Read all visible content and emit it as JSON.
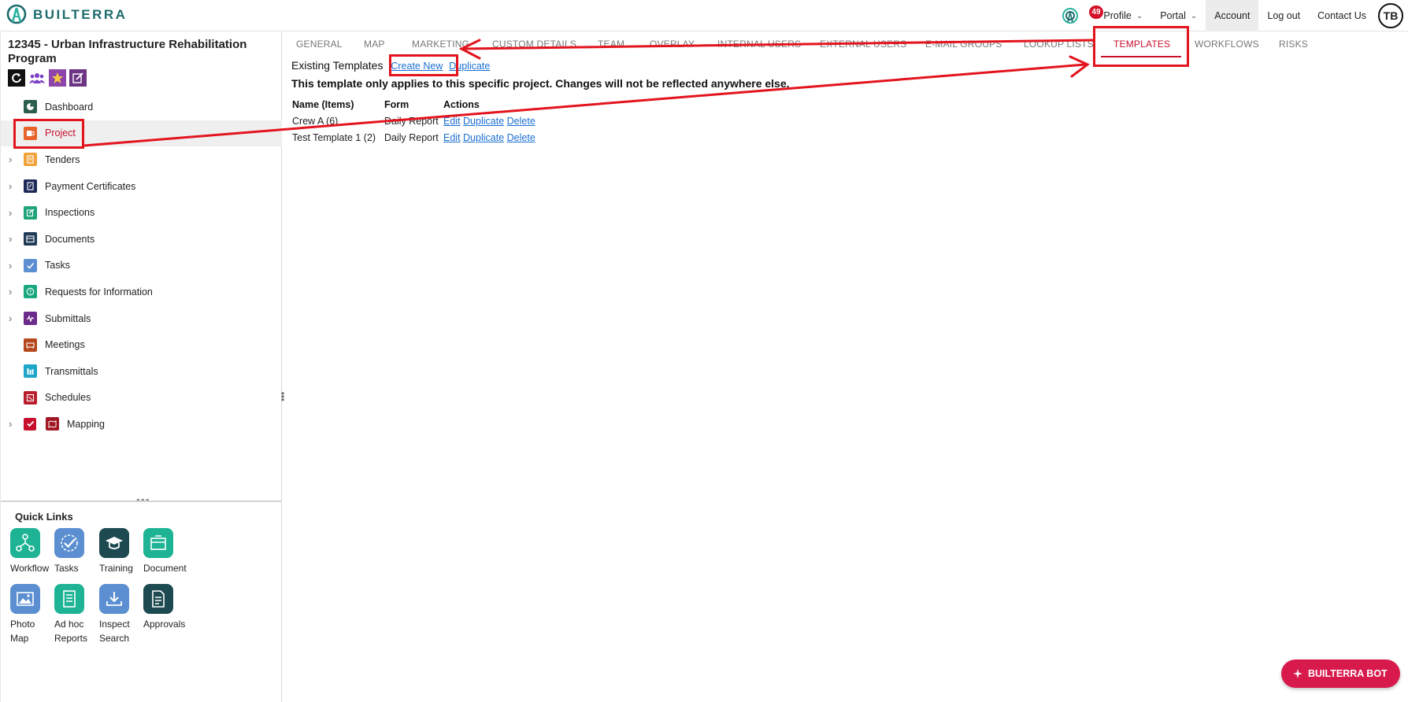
{
  "app": {
    "brand": "BUILTERRA"
  },
  "topnav": {
    "notification_count": "49",
    "profile": "Profile",
    "portal": "Portal",
    "account": "Account",
    "logout": "Log out",
    "contact": "Contact Us",
    "avatar_initials": "TB"
  },
  "project": {
    "title": "12345 - Urban Infrastructure Rehabilitation Program"
  },
  "sidebar": {
    "items": [
      {
        "label": "Dashboard"
      },
      {
        "label": "Project"
      },
      {
        "label": "Tenders"
      },
      {
        "label": "Payment Certificates"
      },
      {
        "label": "Inspections"
      },
      {
        "label": "Documents"
      },
      {
        "label": "Tasks"
      },
      {
        "label": "Requests for Information"
      },
      {
        "label": "Submittals"
      },
      {
        "label": "Meetings"
      },
      {
        "label": "Transmittals"
      },
      {
        "label": "Schedules"
      },
      {
        "label": "Mapping"
      }
    ]
  },
  "quick_links": {
    "title": "Quick Links",
    "items": [
      {
        "label": "Workflow"
      },
      {
        "label": "Tasks"
      },
      {
        "label": "Training"
      },
      {
        "label": "Document"
      },
      {
        "label": "Photo Map"
      },
      {
        "label": "Ad hoc Reports"
      },
      {
        "label": "Inspect Search"
      },
      {
        "label": "Approvals"
      }
    ]
  },
  "tabs": [
    {
      "label": "GENERAL"
    },
    {
      "label": "MAP"
    },
    {
      "label": "MARKETING"
    },
    {
      "label": "CUSTOM DETAILS"
    },
    {
      "label": "TEAM"
    },
    {
      "label": "OVERLAY"
    },
    {
      "label": "INTERNAL USERS"
    },
    {
      "label": "EXTERNAL USERS"
    },
    {
      "label": "E-MAIL GROUPS"
    },
    {
      "label": "LOOKUP LISTS"
    },
    {
      "label": "TEMPLATES"
    },
    {
      "label": "WORKFLOWS"
    },
    {
      "label": "RISKS"
    }
  ],
  "templates": {
    "heading": "Existing Templates",
    "create_new": "Create New",
    "duplicate": "Duplicate",
    "note": "This template only applies to this specific project. Changes will not be reflected anywhere else.",
    "columns": [
      "Name (Items)",
      "Form",
      "Actions"
    ],
    "rows": [
      {
        "name": "Crew A (6)",
        "form": "Daily Report",
        "actions": [
          "Edit",
          "Duplicate",
          "Delete"
        ]
      },
      {
        "name": "Test Template 1 (2)",
        "form": "Daily Report",
        "actions": [
          "Edit",
          "Duplicate",
          "Delete"
        ]
      }
    ]
  },
  "bot": {
    "label": "BUILTERRA BOT"
  },
  "colors": {
    "brand_teal": "#1d6b6c",
    "accent_red": "#c8102e",
    "link_blue": "#1a6fd1",
    "annotation_red": "#e3141e",
    "bot_pink": "#d8194c"
  }
}
